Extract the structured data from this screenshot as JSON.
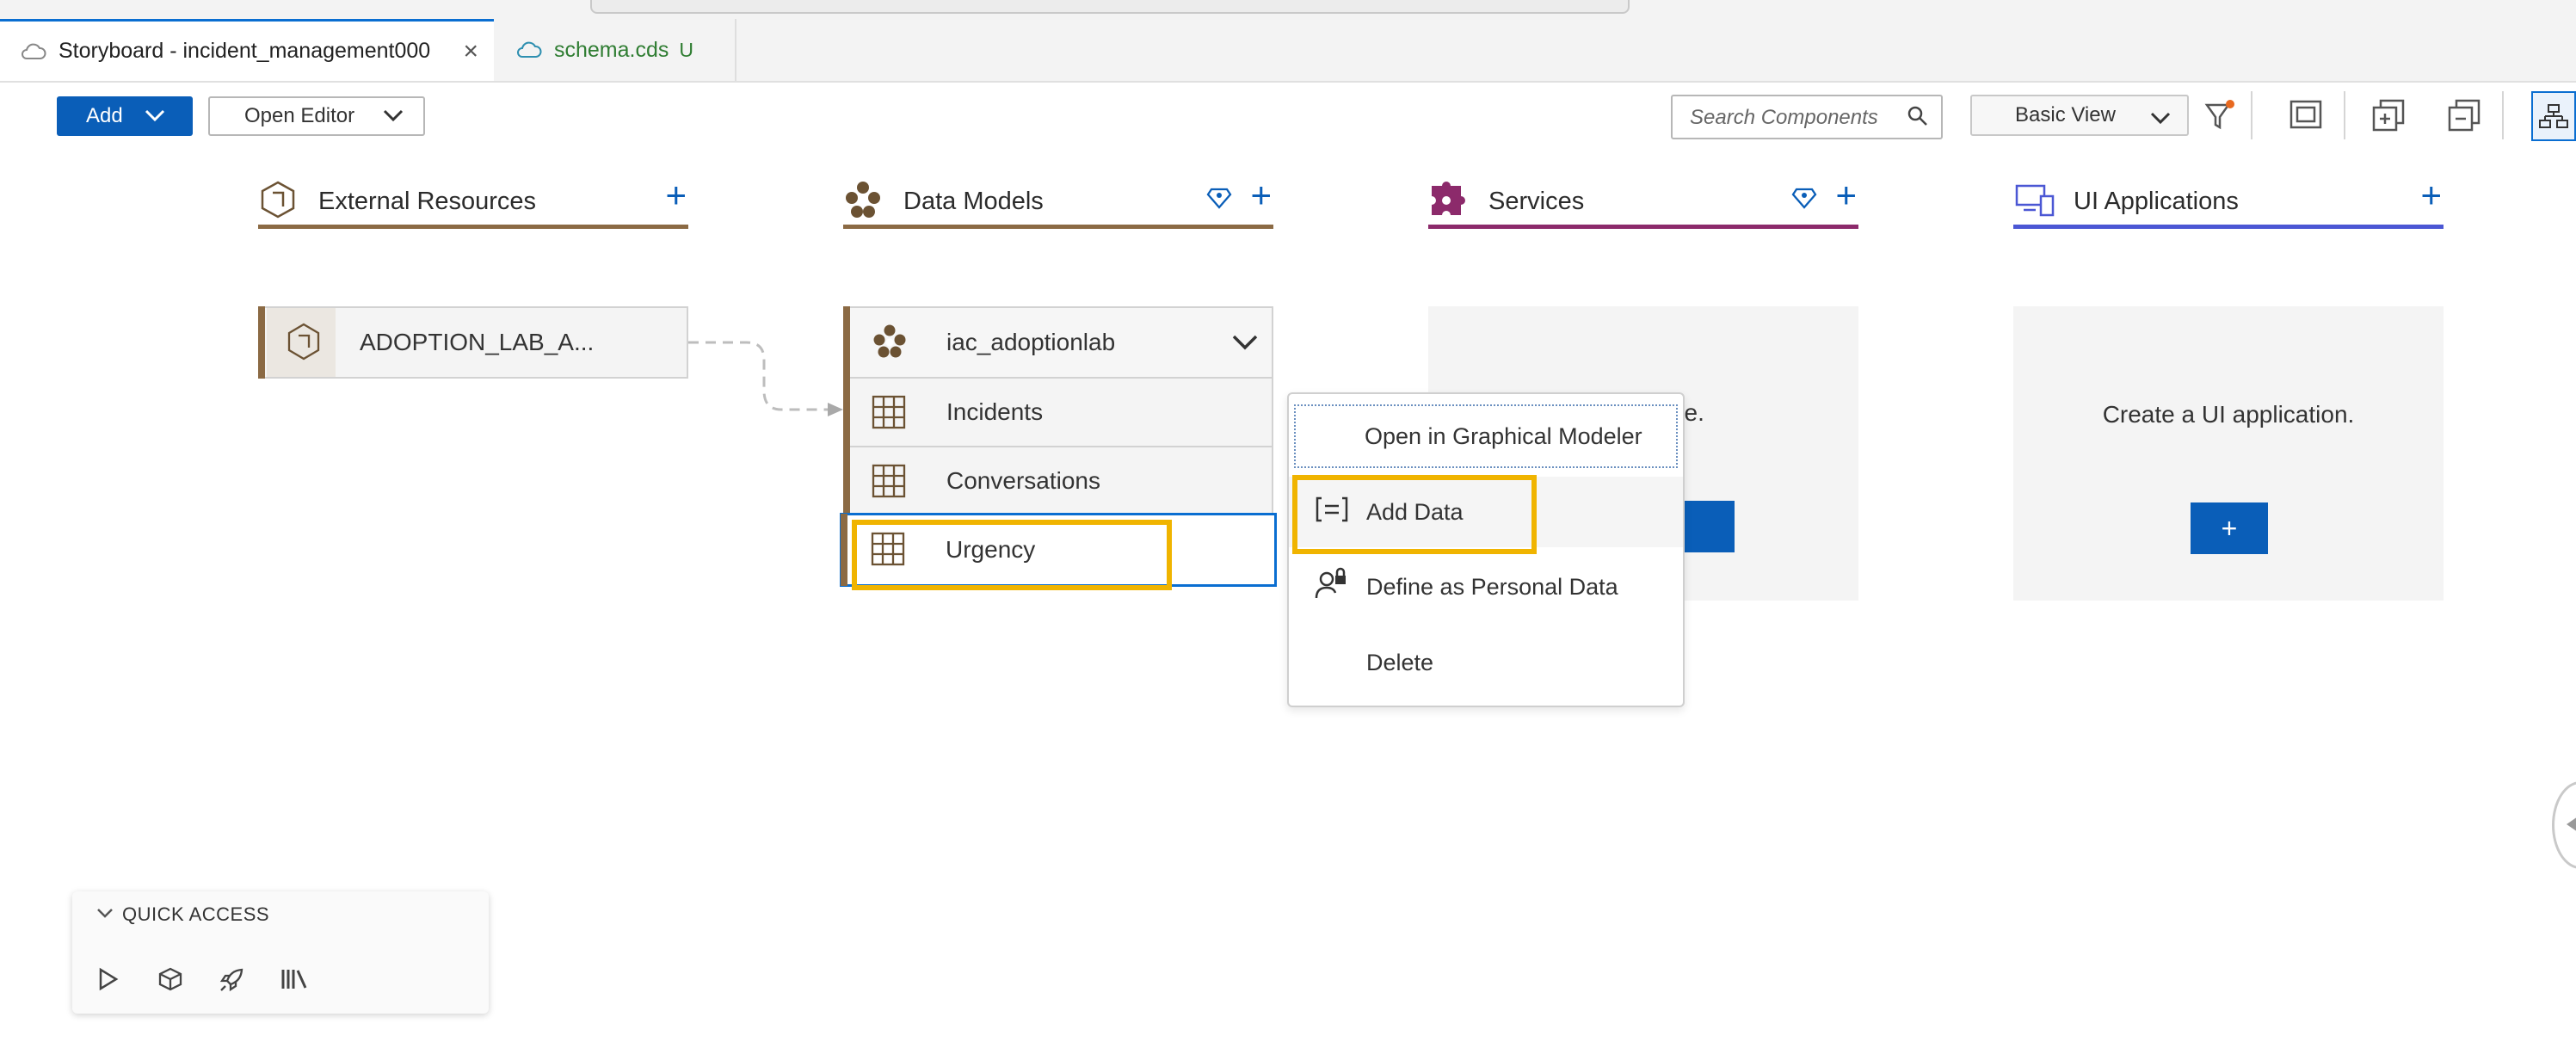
{
  "tabs": [
    {
      "label": "Storyboard - incident_management000",
      "active": true
    },
    {
      "label": "schema.cds",
      "badge": "U",
      "active": false
    }
  ],
  "toolbar": {
    "add_label": "Add",
    "open_editor_label": "Open Editor",
    "search_placeholder": "Search Components",
    "view_label": "Basic View"
  },
  "columns": {
    "external": {
      "title": "External Resources"
    },
    "datamodels": {
      "title": "Data Models"
    },
    "services": {
      "title": "Services"
    },
    "ui": {
      "title": "UI Applications"
    }
  },
  "external_items": [
    {
      "label": "ADOPTION_LAB_A..."
    }
  ],
  "datamodel": {
    "name": "iac_adoptionlab",
    "entities": [
      {
        "label": "Incidents"
      },
      {
        "label": "Conversations"
      },
      {
        "label": "Urgency"
      }
    ]
  },
  "services_empty_text": "rvice.",
  "ui_empty_text": "Create a UI application.",
  "ui_add_label": "+",
  "context_menu": [
    {
      "label": "Open in Graphical Modeler",
      "icon": ""
    },
    {
      "label": "Add Data",
      "icon": "add-data-icon"
    },
    {
      "label": "Define as Personal Data",
      "icon": "personal-data-icon"
    },
    {
      "label": "Delete",
      "icon": ""
    }
  ],
  "quick_access": {
    "title": "QUICK ACCESS"
  },
  "colors": {
    "accent": "#0a5eb8",
    "external_line": "#8b6a44",
    "datamodel_line": "#8b6a44",
    "services_line": "#8c2a6b",
    "ui_line": "#4b57d4",
    "highlight": "#f0b400"
  }
}
